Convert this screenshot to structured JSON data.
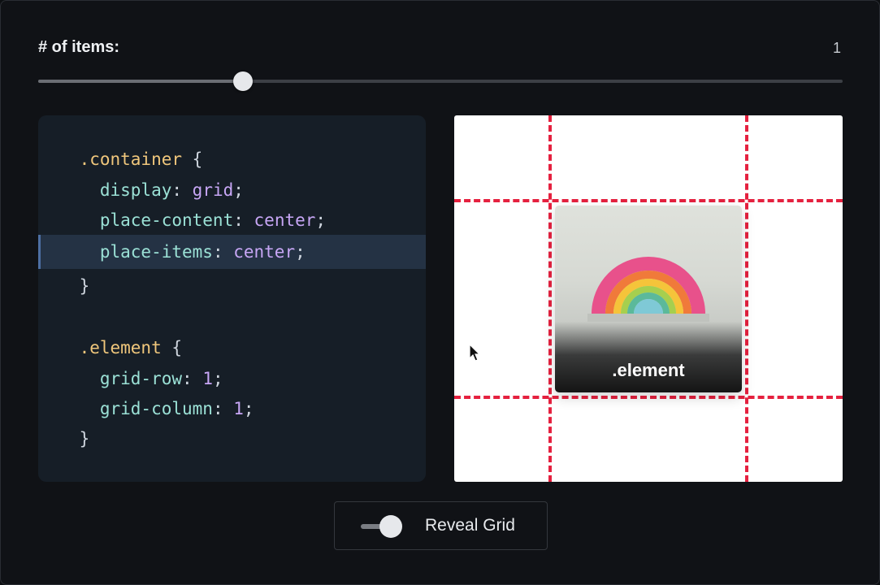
{
  "controls": {
    "items_label": "# of items:",
    "items_count": "1",
    "slider_value_fraction": 0.255
  },
  "code": {
    "container_selector": ".container",
    "open_brace": " {",
    "close_brace": "}",
    "display_prop": "display",
    "display_value": "grid",
    "place_content_prop": "place-content",
    "place_content_value": "center",
    "place_items_prop": "place-items",
    "place_items_value": "center",
    "element_selector": ".element",
    "grid_row_prop": "grid-row",
    "grid_row_value": "1",
    "grid_column_prop": "grid-column",
    "grid_column_value": "1",
    "colon": ": ",
    "semicolon": ";"
  },
  "preview": {
    "element_label": ".element",
    "gridline_color": "#e5213f"
  },
  "toggle": {
    "label": "Reveal Grid",
    "state": "on"
  }
}
